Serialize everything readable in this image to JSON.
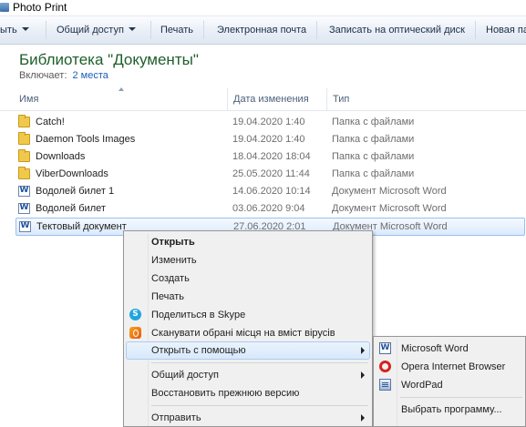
{
  "window": {
    "title": "Photo Print"
  },
  "toolbar": {
    "items": [
      {
        "label": "ыть",
        "has_caret": true
      },
      {
        "label": "Общий доступ",
        "has_caret": true
      },
      {
        "label": "Печать"
      },
      {
        "label": "Электронная почта"
      },
      {
        "label": "Записать на оптический диск"
      },
      {
        "label": "Новая па"
      }
    ]
  },
  "library": {
    "title": "Библиотека \"Документы\"",
    "includes_label": "Включает:",
    "includes_link": "2 места"
  },
  "columns": {
    "name": "Имя",
    "date": "Дата изменения",
    "type": "Тип"
  },
  "files": [
    {
      "name": "Catch!",
      "date": "19.04.2020 1:40",
      "type": "Папка с файлами",
      "icon": "folder-icon"
    },
    {
      "name": "Daemon Tools Images",
      "date": "19.04.2020 1:40",
      "type": "Папка с файлами",
      "icon": "folder-icon"
    },
    {
      "name": "Downloads",
      "date": "18.04.2020 18:04",
      "type": "Папка с файлами",
      "icon": "folder-icon"
    },
    {
      "name": "ViberDownloads",
      "date": "25.05.2020 11:44",
      "type": "Папка с файлами",
      "icon": "folder-icon"
    },
    {
      "name": "Водолей билет 1",
      "date": "14.06.2020 10:14",
      "type": "Документ Microsoft Word",
      "icon": "word-doc-icon"
    },
    {
      "name": "Водолей билет",
      "date": "03.06.2020 9:04",
      "type": "Документ Microsoft Word",
      "icon": "word-doc-icon"
    },
    {
      "name": "Тектовый документ",
      "date": "27.06.2020 2:01",
      "type": "Документ Microsoft Word",
      "icon": "word-doc-icon",
      "selected": true
    }
  ],
  "context_menu": {
    "open": "Открыть",
    "edit": "Изменить",
    "create": "Создать",
    "print": "Печать",
    "skype": "Поделиться в Skype",
    "scan": "Сканувати обрані місця на вміст вірусів",
    "open_with": "Открыть с помощью",
    "share": "Общий доступ",
    "restore": "Восстановить прежнюю версию",
    "send_to": "Отправить"
  },
  "open_with_menu": {
    "word": "Microsoft Word",
    "opera": "Opera Internet Browser",
    "wordpad": "WordPad",
    "choose": "Выбрать программу..."
  }
}
